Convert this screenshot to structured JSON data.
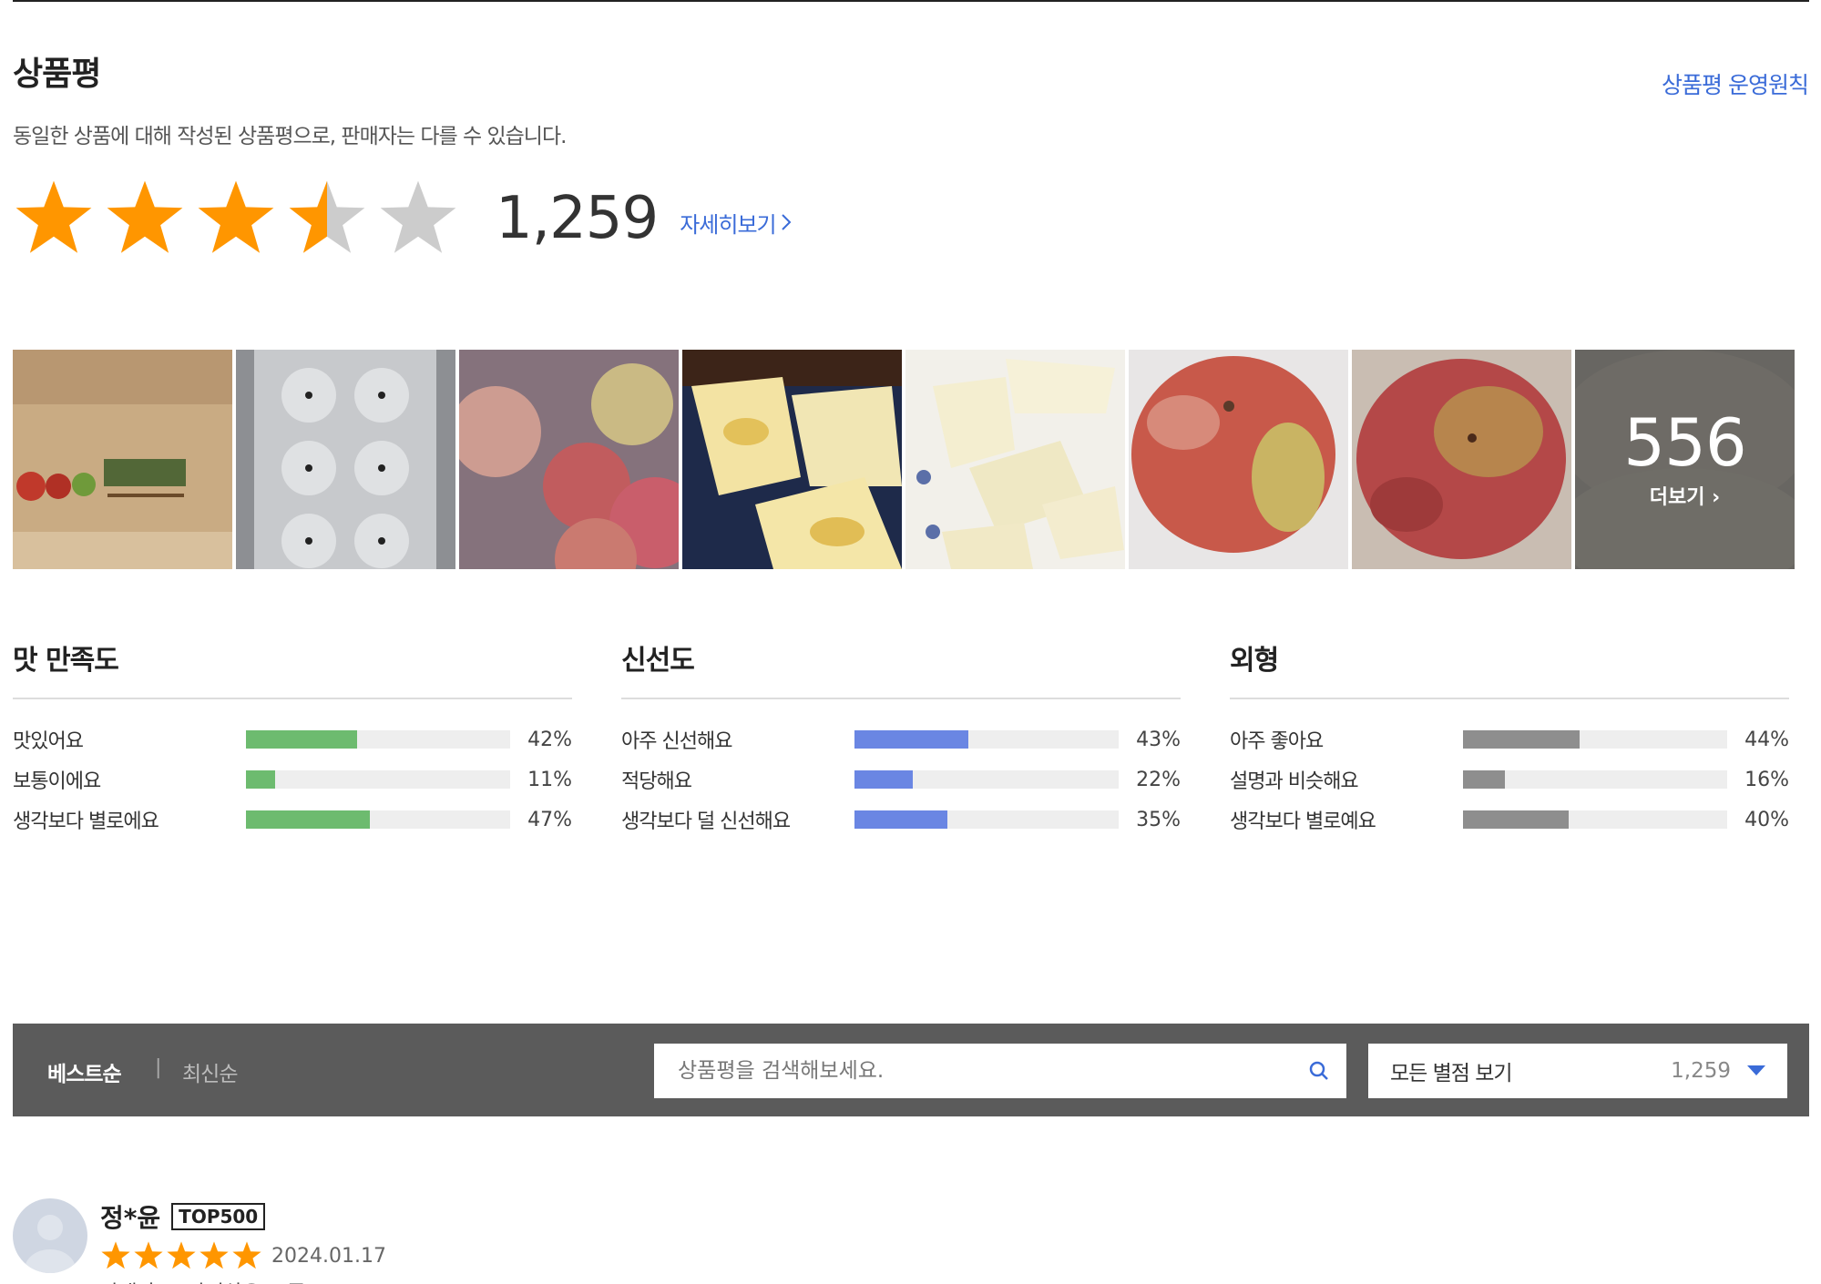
{
  "header": {
    "title": "상품평",
    "policy_link": "상품평 운영원칙",
    "subtitle": "동일한 상품에 대해 작성된 상품평으로, 판매자는 다를 수 있습니다."
  },
  "rating": {
    "stars_value": 3.5,
    "stars_max": 5,
    "count": "1,259",
    "detail_link": "자세히보기"
  },
  "photos": {
    "items": [
      "photo-box",
      "photo-tray",
      "photo-bag",
      "photo-peeled",
      "photo-slices",
      "photo-apple-1",
      "photo-apple-2"
    ],
    "more_count": "556",
    "more_label": "더보기"
  },
  "metrics": [
    {
      "title": "맛 만족도",
      "color": "#6dbb6f",
      "rows": [
        {
          "label": "맛있어요",
          "pct_text": "42%",
          "value": 0.42
        },
        {
          "label": "보통이에요",
          "pct_text": "11%",
          "value": 0.11
        },
        {
          "label": "생각보다 별로에요",
          "pct_text": "47%",
          "value": 0.47
        }
      ]
    },
    {
      "title": "신선도",
      "color": "#6a86e3",
      "rows": [
        {
          "label": "아주 신선해요",
          "pct_text": "43%",
          "value": 0.43
        },
        {
          "label": "적당해요",
          "pct_text": "22%",
          "value": 0.22
        },
        {
          "label": "생각보다 덜 신선해요",
          "pct_text": "35%",
          "value": 0.35
        }
      ]
    },
    {
      "title": "외형",
      "color": "#8e8e8e",
      "rows": [
        {
          "label": "아주 좋아요",
          "pct_text": "44%",
          "value": 0.44
        },
        {
          "label": "설명과 비슷해요",
          "pct_text": "16%",
          "value": 0.16
        },
        {
          "label": "생각보다 별로예요",
          "pct_text": "40%",
          "value": 0.4
        }
      ]
    }
  ],
  "toolbar": {
    "sort_best": "베스트순",
    "sort_sep": "|",
    "sort_new": "최신순",
    "search_placeholder": "상품평을 검색해보세요.",
    "filter_label": "모든 별점 보기",
    "filter_count": "1,259"
  },
  "review": {
    "name": "정*윤",
    "badge": "TOP500",
    "stars_value": 5,
    "date": "2024.01.17",
    "seller": "판매자: 프라이상우오(주)"
  },
  "colors": {
    "star_on": "#ff9600",
    "star_off": "#cccccc",
    "link": "#3a6bd8",
    "toolbar_bg": "#5b5b5b"
  }
}
